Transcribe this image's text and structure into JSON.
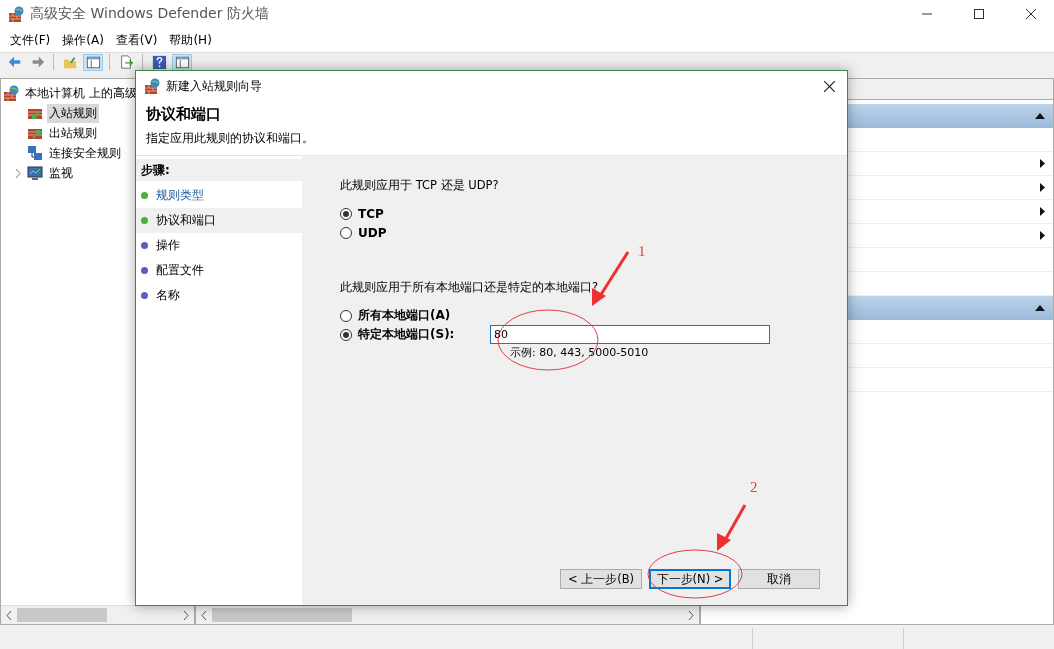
{
  "window": {
    "title": "高级安全 Windows Defender 防火墙"
  },
  "menu": [
    {
      "label": "文件(F)"
    },
    {
      "label": "操作(A)"
    },
    {
      "label": "查看(V)"
    },
    {
      "label": "帮助(H)"
    }
  ],
  "toolbar": [
    {
      "kind": "back",
      "pressed": false
    },
    {
      "kind": "forward",
      "pressed": false
    },
    {
      "kind": "sep"
    },
    {
      "kind": "folder",
      "pressed": false
    },
    {
      "kind": "panel",
      "pressed": true
    },
    {
      "kind": "sep"
    },
    {
      "kind": "export",
      "pressed": false
    },
    {
      "kind": "sep"
    },
    {
      "kind": "help",
      "pressed": false
    },
    {
      "kind": "panel",
      "pressed": true
    }
  ],
  "tree": {
    "label": "本地计算机 上的高级",
    "children": [
      {
        "label": "入站规则",
        "kind": "inbound",
        "selected": true,
        "collapsed": false
      },
      {
        "label": "出站规则",
        "kind": "outbound",
        "selected": false,
        "collapsed": false
      },
      {
        "label": "连接安全规则",
        "kind": "connection",
        "selected": false,
        "collapsed": false
      },
      {
        "label": "监视",
        "kind": "monitor",
        "selected": false,
        "collapsed": true
      }
    ]
  },
  "actions": [
    {
      "expanded": true,
      "rows": [
        {
          "submenu": false
        },
        {
          "submenu": true
        },
        {
          "submenu": true
        },
        {
          "submenu": true
        },
        {
          "submenu": true
        },
        {
          "submenu": false
        },
        {
          "submenu": false
        }
      ]
    },
    {
      "expanded": true,
      "rows": [
        {
          "submenu": false
        },
        {
          "submenu": false
        },
        {
          "submenu": false
        }
      ]
    }
  ],
  "dialog": {
    "title": "新建入站规则向导",
    "heading": "协议和端口",
    "description": "指定应用此规则的协议和端口。",
    "steps_label": "步骤:",
    "steps": [
      {
        "label": "规则类型",
        "color": "#4cae3c",
        "link": true,
        "selected": false
      },
      {
        "label": "协议和端口",
        "color": "#4cae3c",
        "link": false,
        "selected": true
      },
      {
        "label": "操作",
        "color": "#5a5fbf",
        "link": false,
        "selected": false
      },
      {
        "label": "配置文件",
        "color": "#5a5fbf",
        "link": false,
        "selected": false
      },
      {
        "label": "名称",
        "color": "#5a5fbf",
        "link": false,
        "selected": false
      }
    ],
    "protocol_question": "此规则应用于 TCP 还是 UDP?",
    "protocols": [
      {
        "label": "TCP",
        "selected": true
      },
      {
        "label": "UDP",
        "selected": false
      }
    ],
    "port_question": "此规则应用于所有本地端口还是特定的本地端口?",
    "port_options": [
      {
        "label": "所有本地端口(A)",
        "selected": false
      },
      {
        "label": "特定本地端口(S):",
        "selected": true
      }
    ],
    "port_value": "80",
    "port_example": "示例: 80, 443, 5000-5010",
    "buttons": [
      {
        "label": "< 上一步(B)",
        "default": false
      },
      {
        "label": "下一步(N) >",
        "default": true
      },
      {
        "label": "取消",
        "default": false
      }
    ]
  },
  "annotations": [
    {
      "label": "1"
    },
    {
      "label": "2"
    }
  ]
}
